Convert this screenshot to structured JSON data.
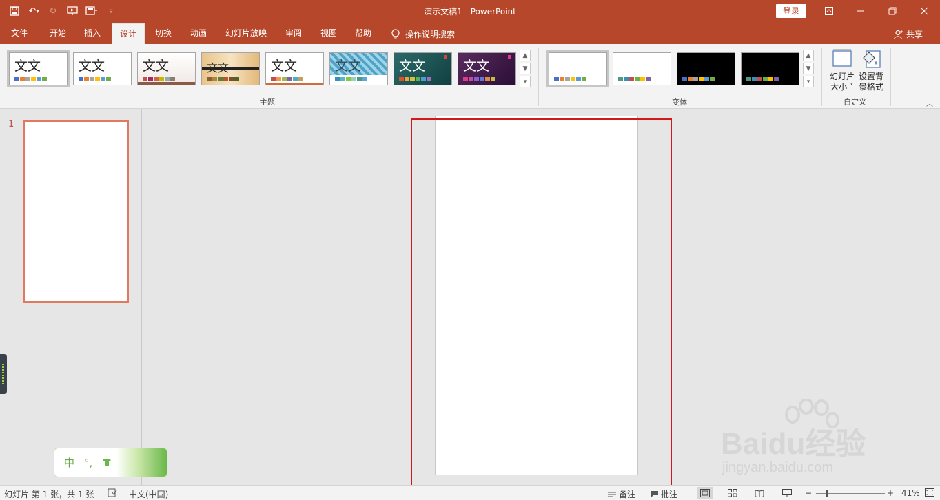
{
  "window": {
    "title": "演示文稿1  -  PowerPoint",
    "login_label": "登录",
    "share_label": "共享"
  },
  "tabs": [
    {
      "label": "文件"
    },
    {
      "label": "开始"
    },
    {
      "label": "插入"
    },
    {
      "label": "设计",
      "active": true
    },
    {
      "label": "切换"
    },
    {
      "label": "动画"
    },
    {
      "label": "幻灯片放映"
    },
    {
      "label": "审阅"
    },
    {
      "label": "视图"
    },
    {
      "label": "帮助"
    }
  ],
  "tell_me": "操作说明搜索",
  "ribbon": {
    "themes_label": "主题",
    "variants_label": "变体",
    "customize_label": "自定义",
    "theme_sample_text": "文文",
    "slide_size_label": [
      "幻灯片",
      "大小 ˅"
    ],
    "format_bg_label": [
      "设置背",
      "景格式"
    ]
  },
  "thumbnails": {
    "slide_number": "1"
  },
  "ime": {
    "mode": "中",
    "punct": "°,"
  },
  "watermark": {
    "brand": "Baidu经验",
    "url": "jingyan.baidu.com"
  },
  "status": {
    "slide_info": "幻灯片 第 1 张，共 1 张",
    "language": "中文(中国)",
    "notes": "备注",
    "comments": "批注",
    "zoom_minus": "−",
    "zoom_plus": "+",
    "zoom": "41%"
  },
  "colors": {
    "accent": "#b7472a",
    "highlight_box": "#d01a1a",
    "thumb_border": "#e07a5f"
  }
}
